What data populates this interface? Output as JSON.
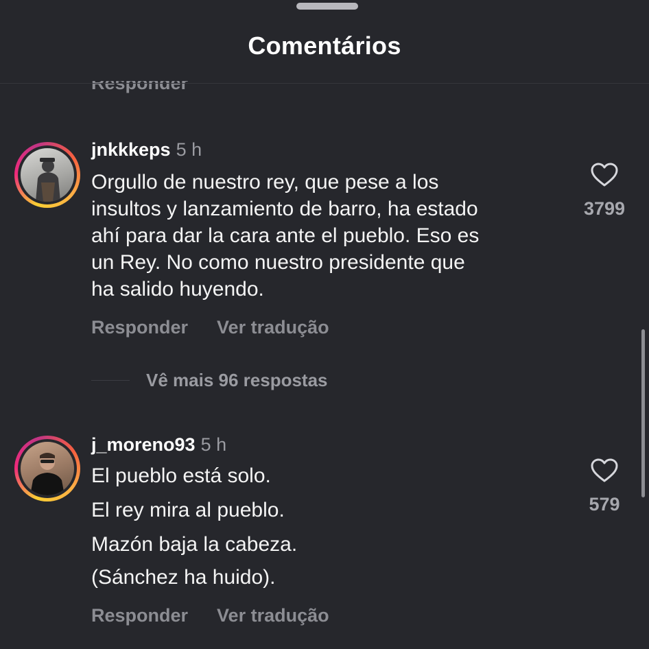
{
  "header": {
    "title": "Comentários"
  },
  "clipped_reply_label": "Responder",
  "comments": [
    {
      "username": "jnkkkeps",
      "time": "5 h",
      "lines": [
        "Orgullo de nuestro rey, que pese a los",
        "insultos y lanzamiento de barro, ha estado",
        "ahí para dar la cara ante el pueblo. Eso es",
        "un Rey. No como nuestro presidente que",
        "ha salido huyendo."
      ],
      "likes": "3799",
      "reply_label": "Responder",
      "translate_label": "Ver tradução",
      "more_replies": "Vê mais 96 respostas"
    },
    {
      "username": "j_moreno93",
      "time": "5 h",
      "lines": [
        "El pueblo está solo.",
        "El rey mira al pueblo.",
        "Mazón baja la cabeza.",
        "(Sánchez ha huido)."
      ],
      "likes": "579",
      "reply_label": "Responder",
      "translate_label": "Ver tradução"
    }
  ],
  "icons": {
    "like": "heart-outline-icon",
    "avatar_ring": "story-ring"
  },
  "colors": {
    "background": "#26272c",
    "ring_start": "#f9ce34",
    "ring_mid": "#ee2a7b",
    "ring_end": "#c13584",
    "secondary_text": "#8c8d93"
  }
}
